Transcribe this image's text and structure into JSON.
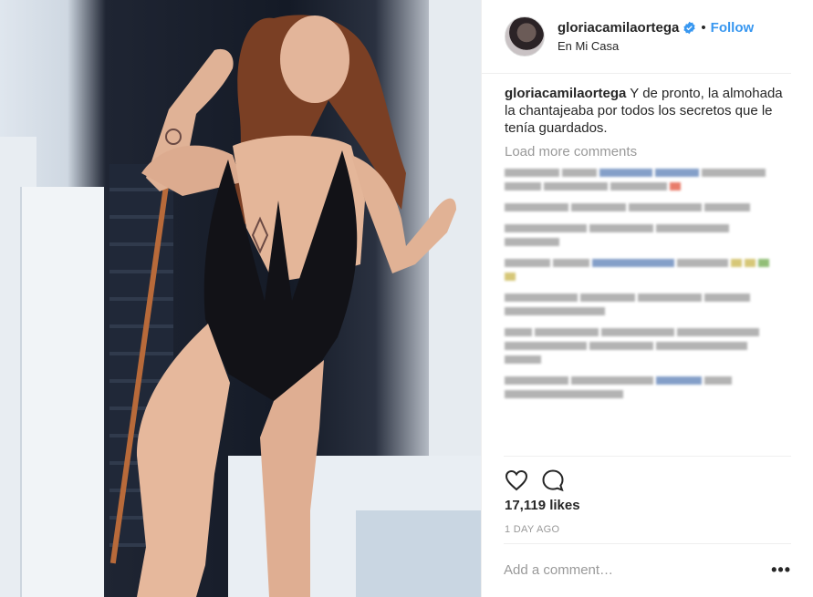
{
  "post": {
    "username": "gloriacamilaortega",
    "verified": true,
    "follow_label": "Follow",
    "separator": "•",
    "location": "En Mi Casa",
    "caption_user": "gloriacamilaortega",
    "caption_text": "Y de pronto, la almohada la chantajeaba por todos los secretos que le tenía guardados.",
    "load_more": "Load more comments",
    "likes": "17,119 likes",
    "time_ago": "1 DAY AGO",
    "comment_placeholder": "Add a comment…",
    "more_options": "•••"
  },
  "colors": {
    "accent": "#3897f0",
    "text": "#262626",
    "muted": "#999999",
    "divider": "#efefef"
  },
  "icons": {
    "like": "heart-icon",
    "comment": "speech-bubble-icon",
    "verified": "verified-badge-icon"
  }
}
